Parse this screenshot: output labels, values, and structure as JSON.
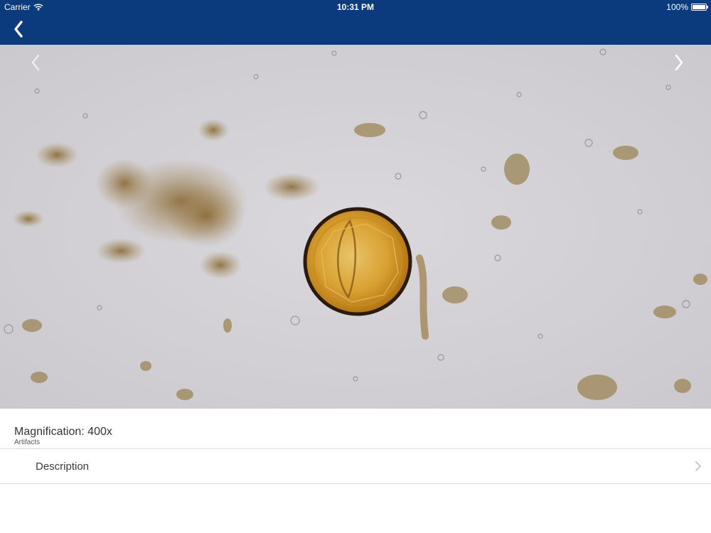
{
  "status_bar": {
    "carrier": "Carrier",
    "time": "10:31 PM",
    "battery": "100%"
  },
  "nav": {
    "back_icon": "chevron-left-icon"
  },
  "viewer": {
    "prev_icon": "chevron-left-icon",
    "next_icon": "chevron-right-icon"
  },
  "info": {
    "magnification": "Magnification: 400x",
    "category": "Artifacts",
    "description_label": "Description"
  },
  "colors": {
    "nav_bar": "#0b3b7c",
    "image_background": "#d5d3d8",
    "divider": "#dcdcdc"
  }
}
